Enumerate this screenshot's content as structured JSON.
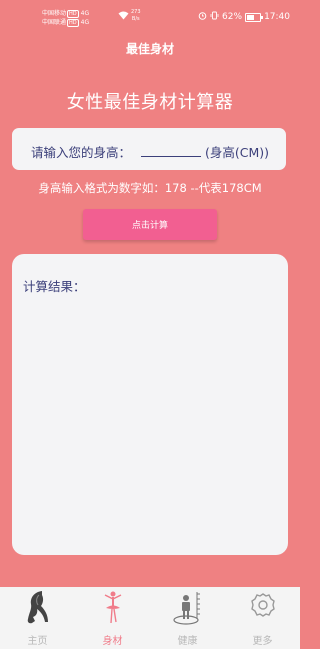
{
  "status_bar": {
    "carrier1": "中国移动",
    "carrier1_badge": "HD",
    "carrier2": "中国联通",
    "carrier2_badge": "HD",
    "signal1": "4G",
    "signal2": "4G",
    "net_speed_value": "273",
    "net_speed_unit": "B/s",
    "battery": "62%",
    "time": "17:40"
  },
  "app": {
    "title": "最佳身材"
  },
  "main": {
    "heading": "女性最佳身材计算器",
    "input_label": "请输入您的身高：",
    "input_value": "",
    "input_unit": "(身高(CM))",
    "hint": "身高输入格式为数字如：178 --代表178CM",
    "calc_button": "点击计算",
    "result_label": "计算结果："
  },
  "bottom_nav": {
    "items": [
      {
        "label": "主页",
        "icon": "woman-silhouette-icon",
        "active": false
      },
      {
        "label": "身材",
        "icon": "ballerina-icon",
        "active": true
      },
      {
        "label": "健康",
        "icon": "height-scale-icon",
        "active": false
      },
      {
        "label": "更多",
        "icon": "gear-icon",
        "active": false
      }
    ]
  },
  "colors": {
    "background": "#ef8182",
    "button": "#f25f91",
    "card": "#f4f4f6",
    "card_text": "#3b3f7a",
    "nav_active": "#f07c8a",
    "nav_inactive": "#b8b8b8"
  }
}
